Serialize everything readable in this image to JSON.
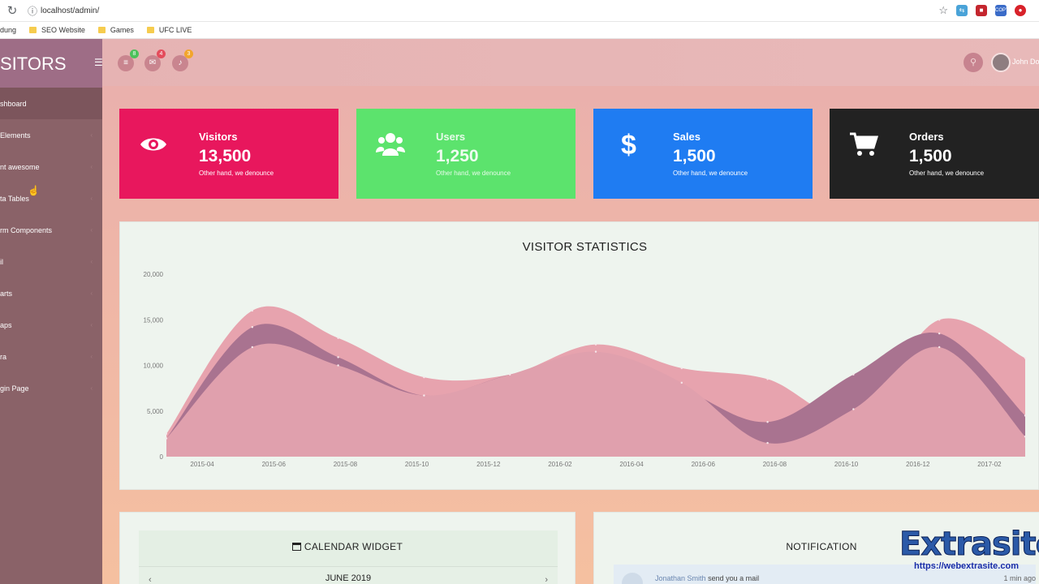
{
  "browser": {
    "url": "localhost/admin/",
    "bookmarks": [
      "dung",
      "SEO Website",
      "Games",
      "UFC LIVE"
    ],
    "ext_copy": "COPY"
  },
  "sidebar": {
    "brand": "SITORS",
    "items": [
      {
        "label": "shboard",
        "active": true
      },
      {
        "label": "Elements"
      },
      {
        "label": "nt awesome"
      },
      {
        "label": "ta Tables"
      },
      {
        "label": "rm Components"
      },
      {
        "label": "il"
      },
      {
        "label": "arts"
      },
      {
        "label": "aps"
      },
      {
        "label": "ra"
      },
      {
        "label": "gin Page"
      }
    ]
  },
  "header": {
    "badges": {
      "tasks": "8",
      "mail": "4",
      "alerts": "3"
    },
    "username": "John Do"
  },
  "cards": [
    {
      "title": "Visitors",
      "value": "13,500",
      "subtitle": "Other hand, we denounce",
      "color": "#e8175d",
      "icon": "eye-icon"
    },
    {
      "title": "Users",
      "value": "1,250",
      "subtitle": "Other hand, we denounce",
      "color": "#5ce36d",
      "icon": "users-icon"
    },
    {
      "title": "Sales",
      "value": "1,500",
      "subtitle": "Other hand, we denounce",
      "color": "#1f7cf2",
      "icon": "dollar-icon"
    },
    {
      "title": "Orders",
      "value": "1,500",
      "subtitle": "Other hand, we denounce",
      "color": "#222222",
      "icon": "cart-icon"
    }
  ],
  "chart_data": {
    "type": "area",
    "title": "VISITOR STATISTICS",
    "x": [
      "2015-04",
      "2015-06",
      "2015-08",
      "2015-10",
      "2015-12",
      "2016-02",
      "2016-04",
      "2016-06",
      "2016-08",
      "2016-10",
      "2016-12",
      "2017-02"
    ],
    "ylim": [
      0,
      20000
    ],
    "y_ticks": [
      "0",
      "5,000",
      "10,000",
      "15,000",
      "20,000"
    ],
    "series": [
      {
        "values": [
          2500,
          16000,
          13000,
          8700,
          9000,
          12300,
          9700,
          8500,
          4500,
          15000,
          10800
        ],
        "color": "#e7a3ae"
      },
      {
        "values": [
          2000,
          14200,
          10900,
          6700,
          9000,
          11000,
          7500,
          3800,
          9000,
          13500,
          4500
        ],
        "color": "#a97390"
      },
      {
        "values": [
          2000,
          12000,
          10000,
          6700,
          9000,
          11500,
          8100,
          1500,
          5200,
          12000,
          2200
        ],
        "color": "#e0a0ad"
      }
    ]
  },
  "calendar": {
    "title": "CALENDAR WIDGET",
    "month": "JUNE 2019"
  },
  "notification": {
    "title": "NOTIFICATION",
    "items": [
      {
        "who": "Jonathan Smith",
        "text": "send you a mail",
        "time": "1 min ago"
      }
    ]
  },
  "watermark": {
    "title": "Extrasite",
    "url": "https://webextrasite.com"
  }
}
